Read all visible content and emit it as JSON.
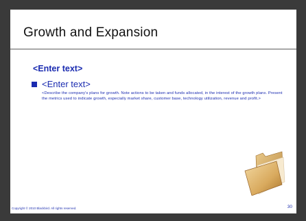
{
  "slide": {
    "title": "Growth and Expansion",
    "subheading": "<Enter text>",
    "bullet": "<Enter text>",
    "body": "<Describe the company's plans for growth.  Note actions to be taken and funds allocated, in the interest of the growth plans.  Present the metrics used to indicate growth, especially market share, customer base, technology utilization, revenue and profit.>",
    "copyright": "Copyright © 2010 Blackbird.  All rights reserved.",
    "page_number": "30",
    "illustration_icon": "folder-icon"
  },
  "colors": {
    "accent": "#1a2bb0",
    "background": "#3a3a3a",
    "slide": "#ffffff"
  }
}
